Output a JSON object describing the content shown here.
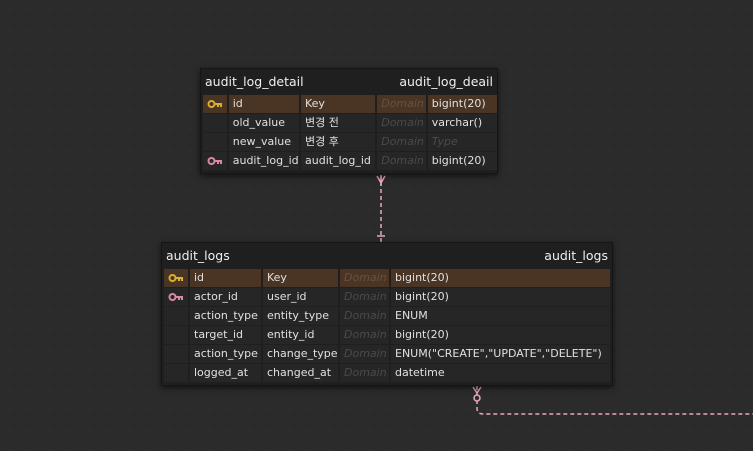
{
  "tables": {
    "audit_log_detail": {
      "logical_name": "audit_log_detail",
      "physical_name": "audit_log_deail",
      "columns": [
        {
          "key": "pk",
          "name": "id",
          "comment": "Key",
          "domain": "Domain",
          "type": "bigint(20)"
        },
        {
          "key": "",
          "name": "old_value",
          "comment": "변경 전",
          "domain": "Domain",
          "type": "varchar()"
        },
        {
          "key": "",
          "name": "new_value",
          "comment": "변경 후",
          "domain": "Domain",
          "type": "Type"
        },
        {
          "key": "fk",
          "name": "audit_log_id",
          "comment": "audit_log_id",
          "domain": "Domain",
          "type": "bigint(20)"
        }
      ]
    },
    "audit_logs": {
      "logical_name": "audit_logs",
      "physical_name": "audit_logs",
      "columns": [
        {
          "key": "pk",
          "name": "id",
          "comment": "Key",
          "domain": "Domain",
          "type": "bigint(20)"
        },
        {
          "key": "fk",
          "name": "actor_id",
          "comment": "user_id",
          "domain": "Domain",
          "type": "bigint(20)"
        },
        {
          "key": "",
          "name": "action_type",
          "comment": "entity_type",
          "domain": "Domain",
          "type": "ENUM"
        },
        {
          "key": "",
          "name": "target_id",
          "comment": "entity_id",
          "domain": "Domain",
          "type": "bigint(20)"
        },
        {
          "key": "",
          "name": "action_type",
          "comment": "change_type",
          "domain": "Domain",
          "type": "ENUM(\"CREATE\",\"UPDATE\",\"DELETE\")"
        },
        {
          "key": "",
          "name": "logged_at",
          "comment": "changed_at",
          "domain": "Domain",
          "type": "datetime"
        }
      ]
    }
  },
  "colors": {
    "pk_key": "#d9b030",
    "fk_key": "#d98aa0",
    "relation_line": "#e8a9b8",
    "pk_row": "#4a3424"
  },
  "icons": {
    "pk": "key-icon",
    "fk": "key-icon"
  }
}
